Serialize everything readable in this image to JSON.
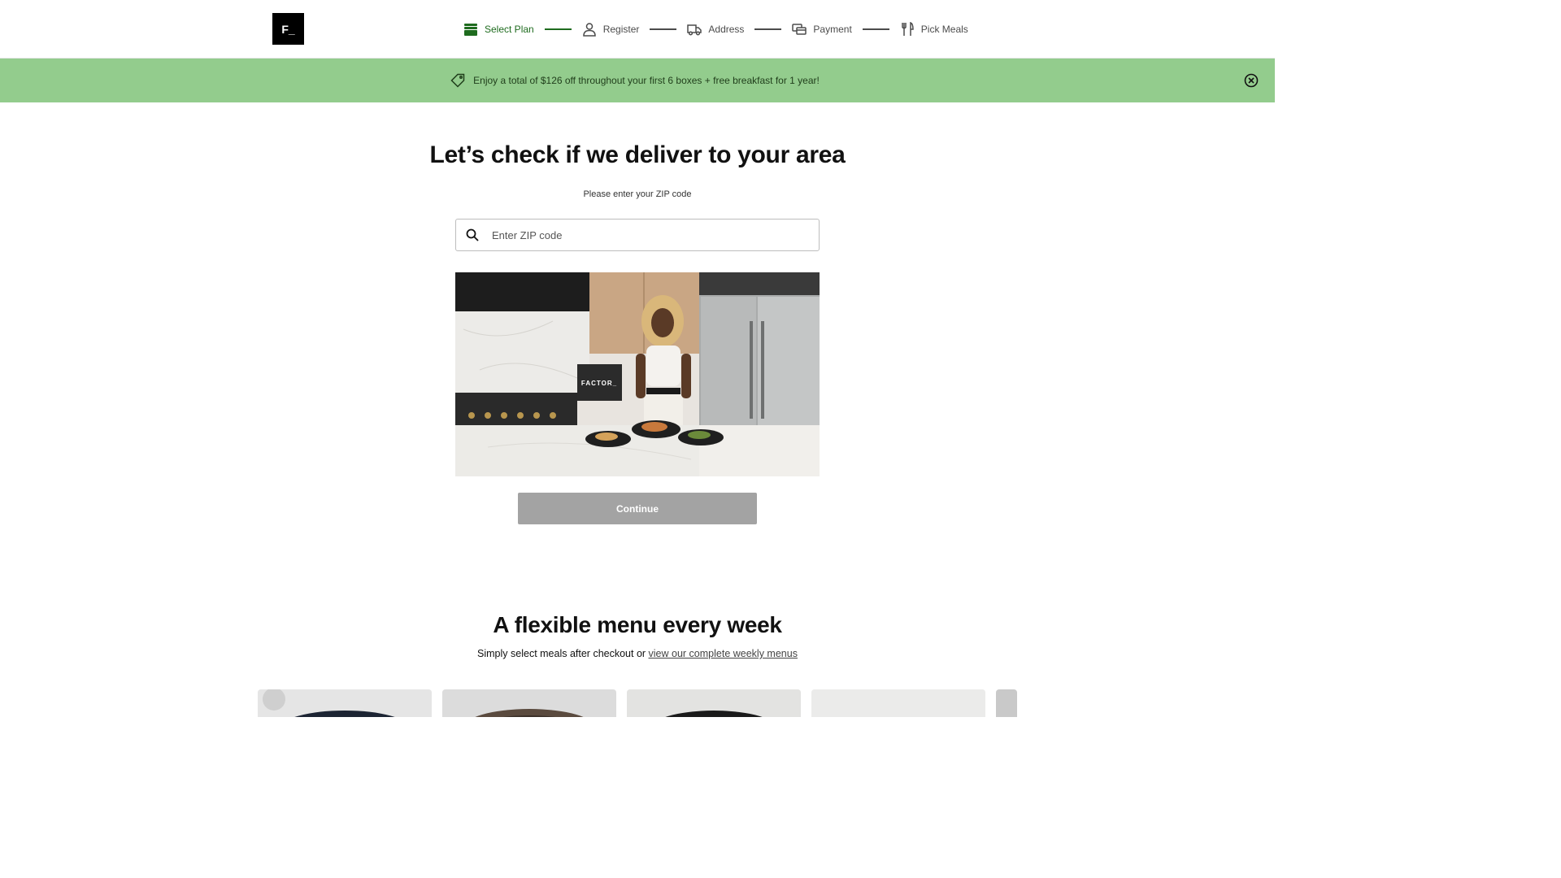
{
  "header": {
    "logo_text": "F_",
    "steps": [
      {
        "label": "Select Plan",
        "icon": "box-icon",
        "active": true
      },
      {
        "label": "Register",
        "icon": "user-icon",
        "active": false
      },
      {
        "label": "Address",
        "icon": "truck-icon",
        "active": false
      },
      {
        "label": "Payment",
        "icon": "card-icon",
        "active": false
      },
      {
        "label": "Pick Meals",
        "icon": "fork-knife-icon",
        "active": false
      }
    ]
  },
  "promo": {
    "text": "Enjoy a total of $126 off throughout your first 6 boxes + free breakfast for 1 year!",
    "icon": "tag-icon",
    "close_icon": "close-circle-icon"
  },
  "main": {
    "title": "Let’s check if we deliver to your area",
    "subtitle": "Please enter your ZIP code",
    "zip_placeholder": "Enter ZIP code",
    "hero_box_text": "FACTOR_",
    "continue_label": "Continue"
  },
  "menu": {
    "title": "A flexible menu every week",
    "subtitle_prefix": "Simply select meals after checkout or ",
    "link_text": "view our complete weekly menus"
  },
  "colors": {
    "promo_bg": "#93cc8d",
    "active_green": "#1e6b1e",
    "button_disabled": "#a3a3a3"
  }
}
